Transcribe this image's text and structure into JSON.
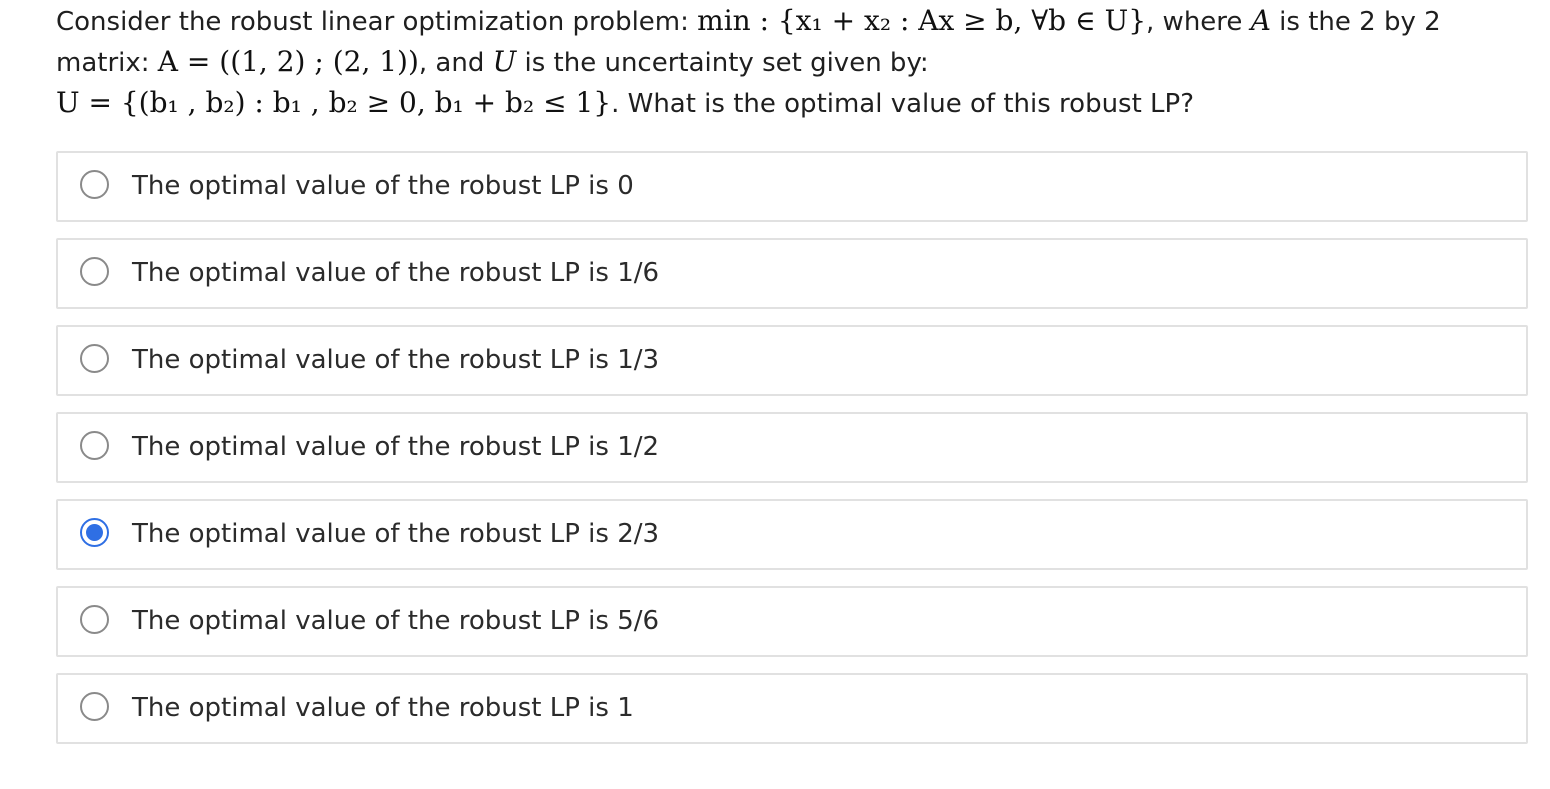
{
  "question": {
    "line1_prefix": "Consider the robust linear optimization problem: ",
    "line1_math": "min : {x₁ + x₂ : Ax ≥ b, ∀b ∈ U}",
    "line1_mid": ", where ",
    "line1_math_A": "A",
    "line1_suffix": " is the 2 by 2",
    "line2_prefix": "matrix: ",
    "line2_math": "A = ((1, 2) ; (2, 1))",
    "line2_mid": ", and ",
    "line2_math_U": "U",
    "line2_suffix": " is the uncertainty set given by:",
    "line3_math": "U = {(b₁ , b₂) : b₁ , b₂ ≥ 0, b₁ + b₂ ≤ 1}",
    "line3_suffix": ". What is the optimal value of this robust LP?"
  },
  "options": [
    {
      "label": "The optimal value of the robust LP is 0",
      "selected": false
    },
    {
      "label": "The optimal value of the robust LP is 1/6",
      "selected": false
    },
    {
      "label": "The optimal value of the robust LP is 1/3",
      "selected": false
    },
    {
      "label": "The optimal value of the robust LP is 1/2",
      "selected": false
    },
    {
      "label": "The optimal value of the robust LP is 2/3",
      "selected": true
    },
    {
      "label": "The optimal value of the robust LP is 5/6",
      "selected": false
    },
    {
      "label": "The optimal value of the robust LP is 1",
      "selected": false
    }
  ],
  "colors": {
    "accent": "#2f6fe4",
    "border": "#e1e1e1",
    "radio_border": "#8a8a8a"
  }
}
